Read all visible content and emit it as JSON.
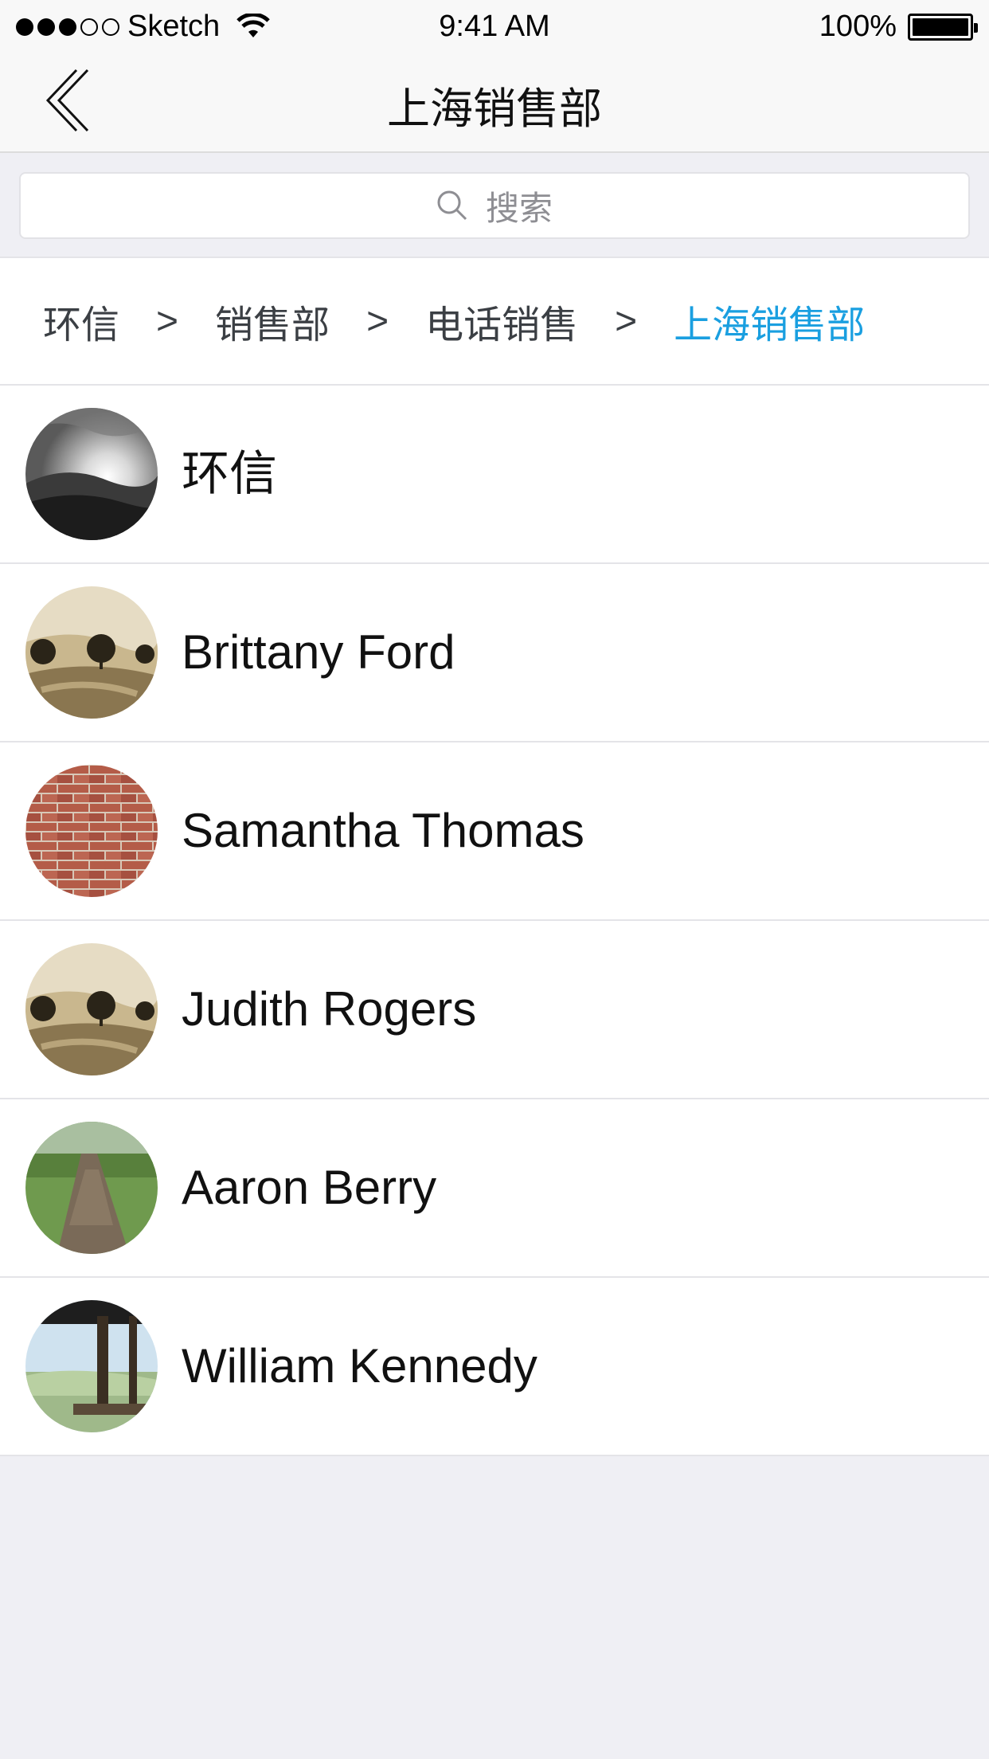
{
  "status_bar": {
    "carrier": "Sketch",
    "time": "9:41 AM",
    "battery": "100%",
    "signal_icon": "signal-dots-icon",
    "wifi_icon": "wifi-icon",
    "battery_icon": "battery-icon"
  },
  "nav": {
    "title": "上海销售部",
    "back_icon": "back-chevron-icon"
  },
  "search": {
    "placeholder": "搜索",
    "icon": "search-icon"
  },
  "breadcrumb": {
    "items": [
      "环信",
      "销售部",
      "电话销售",
      "上海销售部"
    ],
    "separator": ">",
    "current_color": "#1a9fe0"
  },
  "members": [
    {
      "name": "环信",
      "avatar": "sunset-hills-bw"
    },
    {
      "name": "Brittany Ford",
      "avatar": "sepia-trees"
    },
    {
      "name": "Samantha Thomas",
      "avatar": "brick-wall"
    },
    {
      "name": "Judith Rogers",
      "avatar": "sepia-trees"
    },
    {
      "name": "Aaron Berry",
      "avatar": "forest-path"
    },
    {
      "name": "William Kennedy",
      "avatar": "dock-lake"
    }
  ]
}
